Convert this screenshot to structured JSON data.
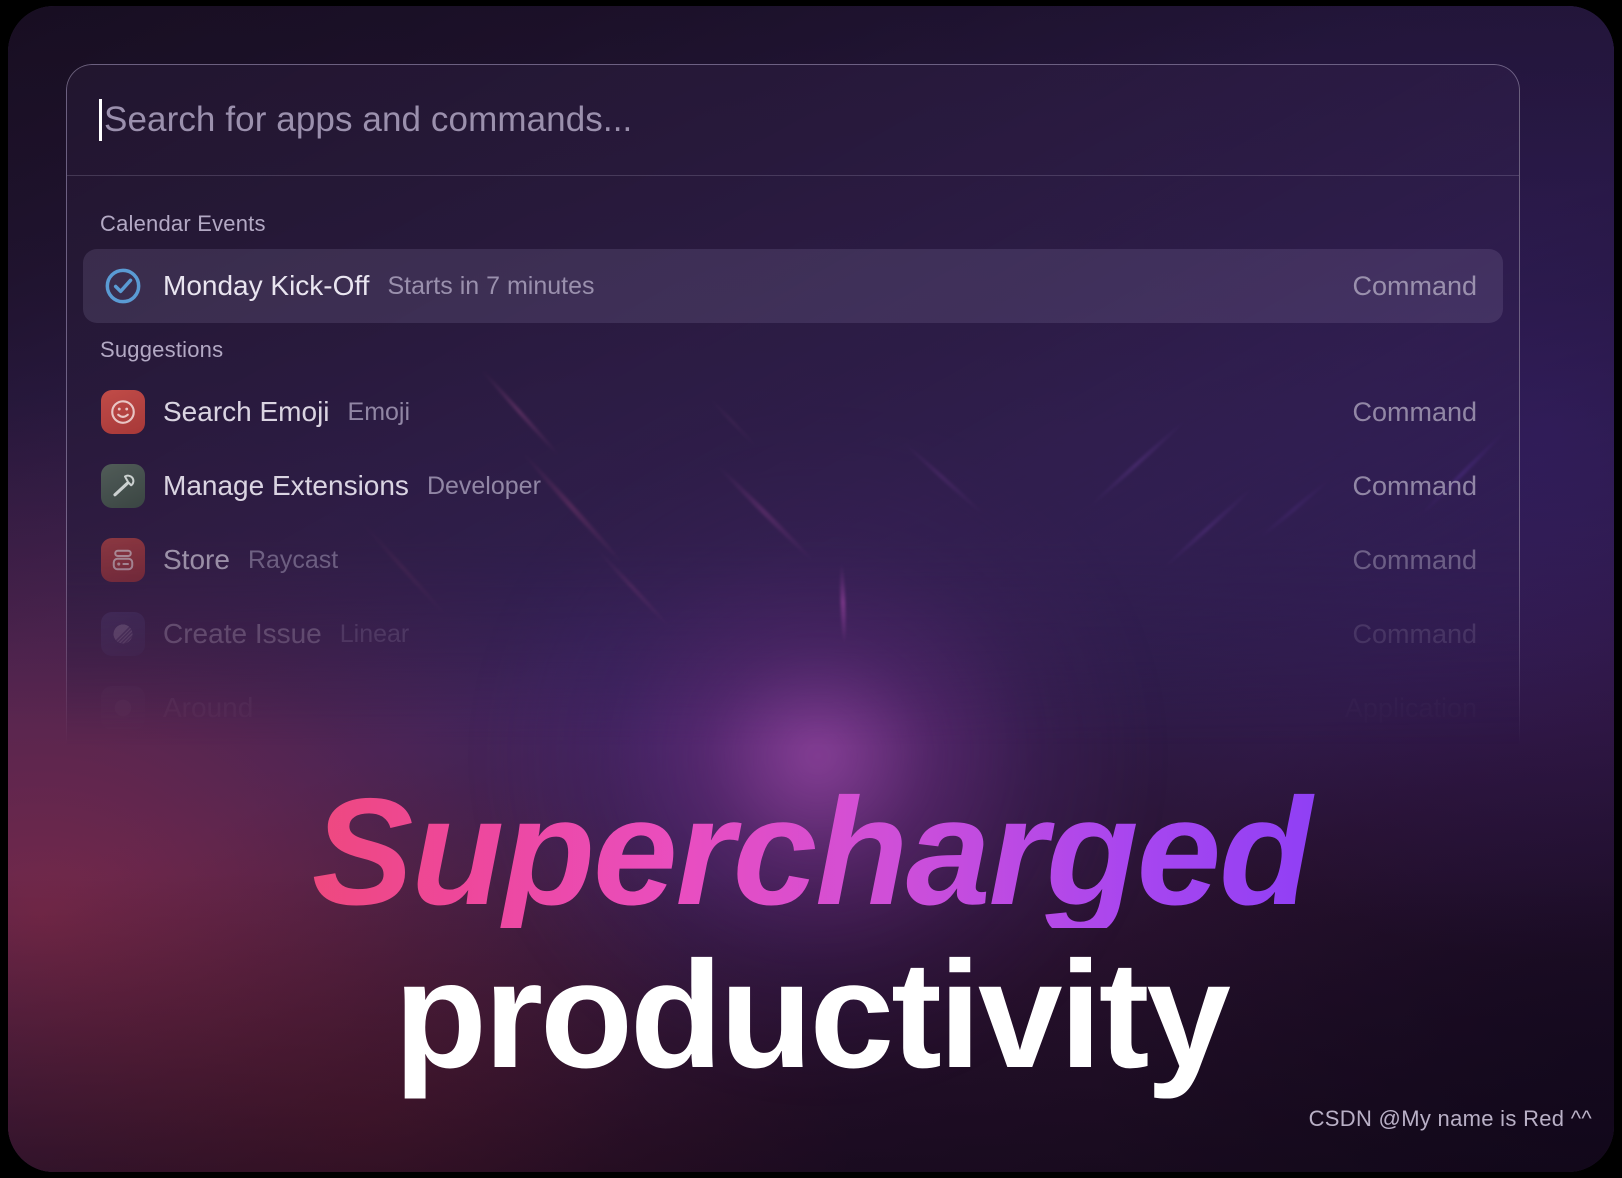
{
  "window": {
    "search": {
      "placeholder": "Search for apps and commands...",
      "value": ""
    },
    "sections": [
      {
        "header": "Calendar Events",
        "items": [
          {
            "icon": "calendar-check-circle-icon",
            "title": "Monday Kick-Off",
            "subtitle": "Starts in 7 minutes",
            "accessory": "Command",
            "selected": true,
            "fade": "f0"
          }
        ]
      },
      {
        "header": "Suggestions",
        "items": [
          {
            "icon": "smiley-face-icon",
            "title": "Search Emoji",
            "subtitle": "Emoji",
            "accessory": "Command",
            "selected": false,
            "fade": "f1"
          },
          {
            "icon": "hammer-icon",
            "title": "Manage Extensions",
            "subtitle": "Developer",
            "accessory": "Command",
            "selected": false,
            "fade": "f1"
          },
          {
            "icon": "robot-store-icon",
            "title": "Store",
            "subtitle": "Raycast",
            "accessory": "Command",
            "selected": false,
            "fade": "f2"
          },
          {
            "icon": "linear-logo-icon",
            "title": "Create Issue",
            "subtitle": "Linear",
            "accessory": "Command",
            "selected": false,
            "fade": "f3"
          },
          {
            "icon": "around-app-icon",
            "title": "Around",
            "subtitle": "",
            "accessory": "Application",
            "selected": false,
            "fade": "f4"
          }
        ]
      }
    ]
  },
  "headline": {
    "line1": "Supercharged",
    "line2": "productivity"
  },
  "watermark": {
    "text": "CSDN @My name is Red ^^"
  },
  "colors": {
    "gradient_start": "#ee4b42",
    "gradient_mid": "#e94ec0",
    "gradient_end": "#6a34f6",
    "headline_line2": "#ffffff",
    "selected_row": "#a898c4",
    "check_blue": "#5a9bd4",
    "emoji_icon_bg": "#c0453f",
    "hammer_icon_bg": "#4a5a52",
    "store_icon_bg": "#b8413c",
    "linear_icon_bg": "#4a3f74"
  }
}
